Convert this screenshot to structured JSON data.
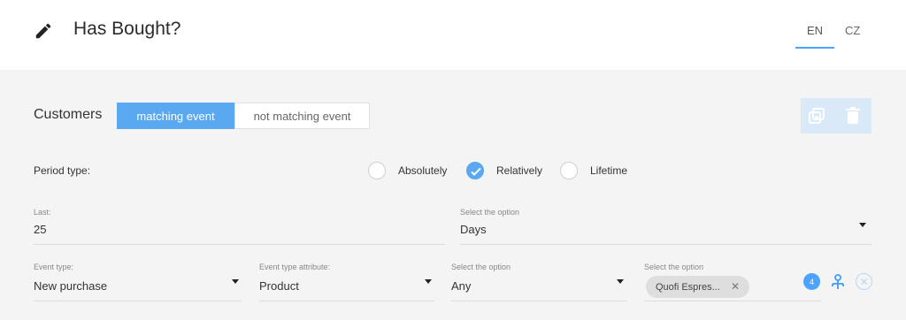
{
  "header": {
    "title": "Has Bought?",
    "languages": [
      "EN",
      "CZ"
    ],
    "active_language": "EN"
  },
  "customers": {
    "label": "Customers",
    "segments": {
      "matching": "matching event",
      "not_matching": "not matching event"
    }
  },
  "period": {
    "label": "Period type:",
    "options": [
      "Absolutely",
      "Relatively",
      "Lifetime"
    ],
    "selected": "Relatively"
  },
  "last": {
    "label": "Last:",
    "value": "25",
    "unit_label": "Select the option",
    "unit_value": "Days"
  },
  "event": {
    "type_label": "Event type:",
    "type_value": "New purchase",
    "attribute_label": "Event type attribute:",
    "attribute_value": "Product",
    "option1_label": "Select the option",
    "option1_value": "Any",
    "option2_label": "Select the option",
    "chip": "Quofi Espres...",
    "count": "4"
  },
  "icons": {
    "edit": "pencil-icon",
    "copy": "copy-icon",
    "delete": "trash-icon",
    "tree": "tree-icon",
    "remove": "close-circle-icon"
  },
  "colors": {
    "accent": "#5aa9f0",
    "action_bg": "#d9e9f8"
  }
}
